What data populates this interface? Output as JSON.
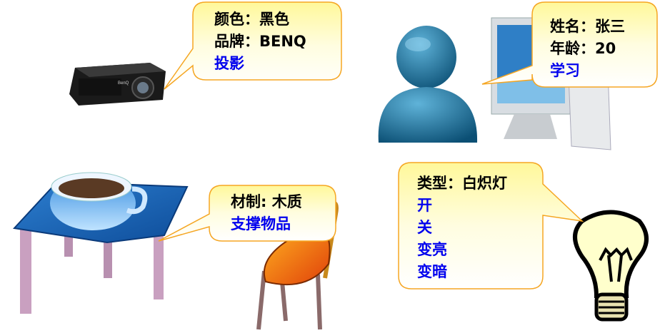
{
  "colors": {
    "callout_border": "#f5a623",
    "callout_fill_top": "#fff89a",
    "callout_fill_bottom": "#ffffff",
    "method_text": "#0000ee",
    "attribute_text": "#000000"
  },
  "projector": {
    "attributes": [
      "颜色：黑色",
      "品牌：BENQ"
    ],
    "methods": [
      "投影"
    ]
  },
  "person": {
    "attributes": [
      "姓名：张三",
      "年龄：20"
    ],
    "methods": [
      "学习"
    ]
  },
  "table": {
    "attributes": [
      "材制: 木质"
    ],
    "methods": [
      "支撑物品"
    ]
  },
  "bulb": {
    "attributes": [
      "类型：白炽灯"
    ],
    "methods": [
      "开",
      "关",
      "变亮",
      "变暗"
    ]
  }
}
